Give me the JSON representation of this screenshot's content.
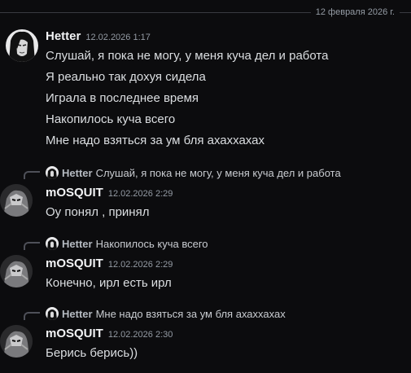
{
  "date_divider": "12 февраля 2026 г.",
  "messages": [
    {
      "author": "Hetter",
      "timestamp": "12.02.2026 1:17",
      "lines": [
        "Слушай, я пока не могу, у меня куча дел и работа",
        "Я реально так дохуя сидела",
        "Играла в последнее время",
        "Накопилось куча всего",
        "Мне надо взяться за ум бля ахаххахах"
      ]
    },
    {
      "reply_to": {
        "author": "Hetter",
        "text": "Слушай, я пока не могу, у меня куча дел и работа"
      },
      "author": "mOSQUIT",
      "timestamp": "12.02.2026 2:29",
      "text": "Оу понял , принял"
    },
    {
      "reply_to": {
        "author": "Hetter",
        "text": "Накопилось куча всего"
      },
      "author": "mOSQUIT",
      "timestamp": "12.02.2026 2:29",
      "text": "Конечно, ирл есть ирл"
    },
    {
      "reply_to": {
        "author": "Hetter",
        "text": "Мне надо взяться за ум бля ахаххахах"
      },
      "author": "mOSQUIT",
      "timestamp": "12.02.2026 2:30",
      "text": "Берись берись))"
    }
  ],
  "icons": {
    "hetter_avatar": "avatar-hetter-icon",
    "mosquit_avatar": "avatar-mosquit-icon"
  },
  "colors": {
    "background": "#0c0c0e",
    "username": "#f2f3f5",
    "message_text": "#dbdee1",
    "timestamp": "#949ba4"
  }
}
